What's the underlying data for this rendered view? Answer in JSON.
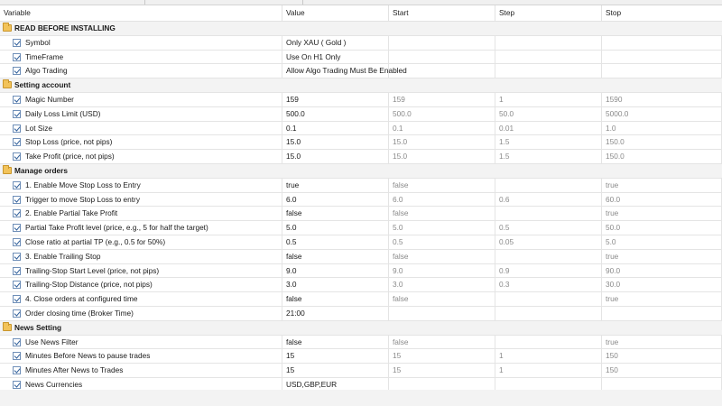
{
  "columns": {
    "variable": "Variable",
    "value": "Value",
    "start": "Start",
    "step": "Step",
    "stop": "Stop"
  },
  "icons": {
    "group": "folder-icon",
    "param": "checkbox-checked-icon"
  },
  "colors": {
    "group_bg": "#f3f3f3",
    "muted_text": "#8a8a8a",
    "folder": "#f2c35a"
  },
  "rows": [
    {
      "type": "group",
      "label": "READ BEFORE INSTALLING"
    },
    {
      "type": "param",
      "name": "Symbol",
      "value": "Only XAU ( Gold )",
      "start": "",
      "step": "",
      "stop": ""
    },
    {
      "type": "param",
      "name": "TimeFrame",
      "value": "Use On H1 Only",
      "start": "",
      "step": "",
      "stop": ""
    },
    {
      "type": "param",
      "name": "Algo Trading",
      "value": "Allow Algo Trading Must Be Enabled",
      "start": "",
      "step": "",
      "stop": ""
    },
    {
      "type": "group",
      "label": "Setting account"
    },
    {
      "type": "param",
      "name": "Magic Number",
      "value": "159",
      "start": "159",
      "step": "1",
      "stop": "1590"
    },
    {
      "type": "param",
      "name": "Daily Loss Limit (USD)",
      "value": "500.0",
      "start": "500.0",
      "step": "50.0",
      "stop": "5000.0"
    },
    {
      "type": "param",
      "name": "Lot Size",
      "value": "0.1",
      "start": "0.1",
      "step": "0.01",
      "stop": "1.0"
    },
    {
      "type": "param",
      "name": "Stop Loss (price, not pips)",
      "value": "15.0",
      "start": "15.0",
      "step": "1.5",
      "stop": "150.0"
    },
    {
      "type": "param",
      "name": "Take Profit (price, not pips)",
      "value": "15.0",
      "start": "15.0",
      "step": "1.5",
      "stop": "150.0"
    },
    {
      "type": "group",
      "label": "Manage orders"
    },
    {
      "type": "param",
      "name": "1. Enable Move Stop Loss to Entry",
      "value": "true",
      "start": "false",
      "step": "",
      "stop": "true"
    },
    {
      "type": "param",
      "name": "Trigger to move Stop Loss to entry",
      "value": "6.0",
      "start": "6.0",
      "step": "0.6",
      "stop": "60.0"
    },
    {
      "type": "param",
      "name": "2. Enable Partial Take Profit",
      "value": "false",
      "start": "false",
      "step": "",
      "stop": "true"
    },
    {
      "type": "param",
      "name": "Partial Take Profit level (price, e.g., 5 for half the target)",
      "value": "5.0",
      "start": "5.0",
      "step": "0.5",
      "stop": "50.0"
    },
    {
      "type": "param",
      "name": "Close ratio at partial TP (e.g., 0.5 for 50%)",
      "value": "0.5",
      "start": "0.5",
      "step": "0.05",
      "stop": "5.0"
    },
    {
      "type": "param",
      "name": "3. Enable Trailing Stop",
      "value": "false",
      "start": "false",
      "step": "",
      "stop": "true"
    },
    {
      "type": "param",
      "name": "Trailing-Stop Start Level (price, not pips)",
      "value": "9.0",
      "start": "9.0",
      "step": "0.9",
      "stop": "90.0"
    },
    {
      "type": "param",
      "name": "Trailing-Stop Distance (price, not pips)",
      "value": "3.0",
      "start": "3.0",
      "step": "0.3",
      "stop": "30.0"
    },
    {
      "type": "param",
      "name": "4. Close orders at configured time",
      "value": "false",
      "start": "false",
      "step": "",
      "stop": "true"
    },
    {
      "type": "param",
      "name": "Order closing time (Broker Time)",
      "value": "21:00",
      "start": "",
      "step": "",
      "stop": ""
    },
    {
      "type": "group",
      "label": "News Setting"
    },
    {
      "type": "param",
      "name": "Use News Filter",
      "value": "false",
      "start": "false",
      "step": "",
      "stop": "true"
    },
    {
      "type": "param",
      "name": "Minutes Before News to pause trades",
      "value": "15",
      "start": "15",
      "step": "1",
      "stop": "150"
    },
    {
      "type": "param",
      "name": "Minutes After News to Trades",
      "value": "15",
      "start": "15",
      "step": "1",
      "stop": "150"
    },
    {
      "type": "param",
      "name": "News Currencies",
      "value": "USD,GBP,EUR",
      "start": "",
      "step": "",
      "stop": ""
    }
  ]
}
